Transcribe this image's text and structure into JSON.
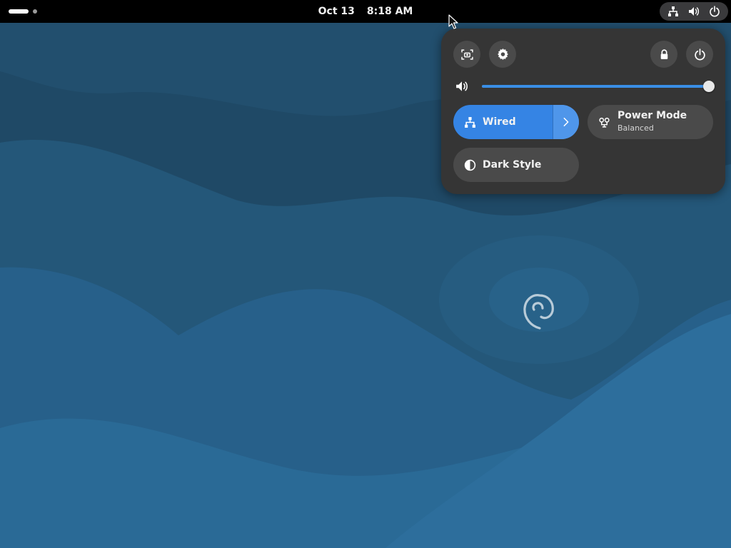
{
  "topbar": {
    "workspace_indicator": "activities",
    "date": "Oct 13",
    "time": "8:18 AM",
    "tray_icons": [
      "network-wired-icon",
      "volume-icon",
      "power-icon"
    ]
  },
  "quick_settings": {
    "buttons": {
      "screenshot": "screenshot-icon",
      "settings": "gear-icon",
      "lock": "lock-icon",
      "power": "power-icon"
    },
    "volume": {
      "icon": "volume-icon",
      "level": 1.0
    },
    "toggles": {
      "wired": {
        "label": "Wired",
        "active": true,
        "icon": "network-wired-icon"
      },
      "power_mode": {
        "label": "Power Mode",
        "subtitle": "Balanced",
        "icon": "power-mode-icon"
      },
      "dark_style": {
        "label": "Dark Style",
        "active": false,
        "icon": "dark-style-icon"
      }
    }
  },
  "colors": {
    "accent": "#3584e4",
    "panel_bg": "#353535",
    "topbar_bg": "#000000",
    "wallpaper_dark": "#1e4a68",
    "wallpaper_light": "#2e6a94"
  }
}
